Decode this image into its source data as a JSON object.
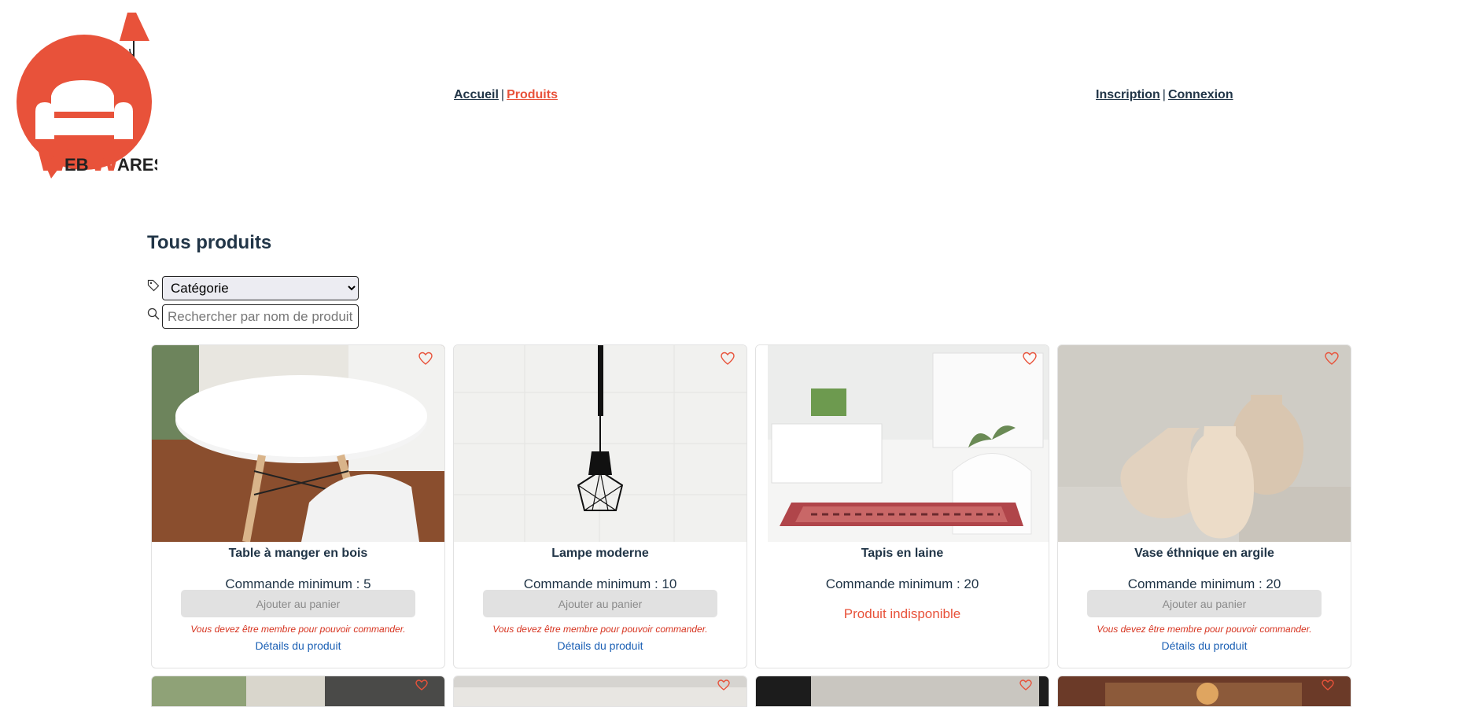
{
  "brand": {
    "name": "WebWares",
    "accent": "#e8523a",
    "text_color": "#213547"
  },
  "nav": {
    "main": [
      {
        "label": "Accueil",
        "active": false
      },
      {
        "label": "Produits",
        "active": true
      }
    ],
    "auth": [
      {
        "label": "Inscription"
      },
      {
        "label": "Connexion"
      }
    ],
    "separator": "|"
  },
  "page": {
    "title": "Tous produits",
    "filters": {
      "category_icon": "tag-icon",
      "category_selected": "Catégorie",
      "search_icon": "search-icon",
      "search_placeholder": "Rechercher par nom de produit"
    }
  },
  "products": [
    {
      "name": "Table à manger en bois",
      "min_order": "Commande minimum : 5",
      "button": "Ajouter au panier",
      "warning": "Vous devez être membre pour pouvoir commander.",
      "details": "Détails du produit",
      "available": true
    },
    {
      "name": "Lampe moderne",
      "min_order": "Commande minimum : 10",
      "button": "Ajouter au panier",
      "warning": "Vous devez être membre pour pouvoir commander.",
      "details": "Détails du produit",
      "available": true
    },
    {
      "name": "Tapis en laine",
      "min_order": "Commande minimum : 20",
      "unavailable": "Produit indisponible",
      "available": false
    },
    {
      "name": "Vase éthnique en argile",
      "min_order": "Commande minimum : 20",
      "button": "Ajouter au panier",
      "warning": "Vous devez être membre pour pouvoir commander.",
      "details": "Détails du produit",
      "available": true
    }
  ],
  "icons": {
    "favorite": "heart-icon"
  }
}
